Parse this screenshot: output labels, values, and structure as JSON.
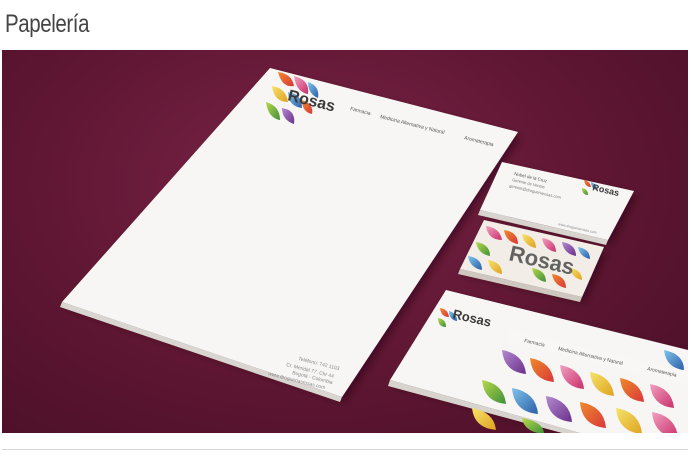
{
  "page": {
    "title": "Papelería"
  },
  "letterhead": {
    "brand": "Rosas",
    "services": [
      "Farmacia",
      "Medicina Alternativa y Natural",
      "Aromaterapia"
    ],
    "contact": [
      "Teléfono: 742 1103",
      "Cr. Meridal 77. Chr 44",
      "Bogotá - Colombia",
      "www.drogueriasrosas.com"
    ]
  },
  "business_card_back": {
    "brand": "Rosas",
    "name": "Nubel de la Cruz",
    "role": "Gerente de Ventas",
    "email": "gerente@drogueriarosas.com",
    "footer": "www.drogueriarosas.com"
  },
  "business_card_front": {
    "brand": "Rosas"
  },
  "envelope": {
    "brand": "Rosas",
    "services": [
      "Farmacia",
      "Medicina Alternativa y Natural",
      "Aromaterapia"
    ]
  },
  "colors": {
    "background": "#5e1632",
    "paper": "#f7f6f4",
    "petal_red": "#d9383a",
    "petal_orange": "#ee8a2a",
    "petal_yellow": "#e8d33a",
    "petal_green": "#6cb33f",
    "petal_blue": "#2c7fc2",
    "petal_purple": "#8a3f9c",
    "petal_pink": "#e2739b"
  }
}
